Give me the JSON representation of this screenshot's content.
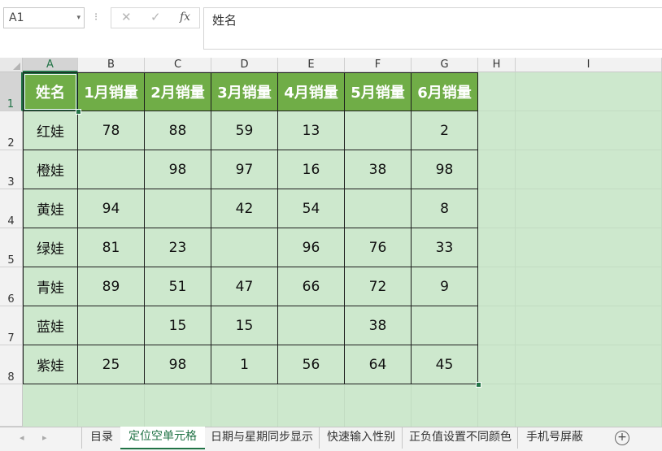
{
  "formula_bar": {
    "name_box": "A1",
    "dropdown_glyph": "▾",
    "separator": "⁝",
    "cancel_glyph": "✕",
    "enter_glyph": "✓",
    "fx_label": "fx",
    "content": "姓名"
  },
  "columns": [
    "A",
    "B",
    "C",
    "D",
    "E",
    "F",
    "G",
    "H",
    "I"
  ],
  "rows": [
    "1",
    "2",
    "3",
    "4",
    "5",
    "6",
    "7",
    "8"
  ],
  "table": {
    "headers": [
      "姓名",
      "1月销量",
      "2月销量",
      "3月销量",
      "4月销量",
      "5月销量",
      "6月销量"
    ],
    "data": [
      [
        "红娃",
        "78",
        "88",
        "59",
        "13",
        "",
        "2"
      ],
      [
        "橙娃",
        "",
        "98",
        "97",
        "16",
        "38",
        "98"
      ],
      [
        "黄娃",
        "94",
        "",
        "42",
        "54",
        "",
        "8"
      ],
      [
        "绿娃",
        "81",
        "23",
        "",
        "96",
        "76",
        "33"
      ],
      [
        "青娃",
        "89",
        "51",
        "47",
        "66",
        "72",
        "9"
      ],
      [
        "蓝娃",
        "",
        "15",
        "15",
        "",
        "38",
        ""
      ],
      [
        "紫娃",
        "25",
        "98",
        "1",
        "56",
        "64",
        "45"
      ]
    ]
  },
  "sheet_tabs": {
    "prev_glyph": "◂",
    "next_glyph": "▸",
    "tabs": [
      "目录",
      "定位空单元格",
      "日期与星期同步显示",
      "快速输入性别",
      "正负值设置不同颜色",
      "手机号屏蔽"
    ],
    "active_index": 1,
    "add_glyph": "+"
  },
  "colors": {
    "header_fill": "#70ad47",
    "sheet_background": "#cde8cd",
    "accent": "#217346"
  }
}
